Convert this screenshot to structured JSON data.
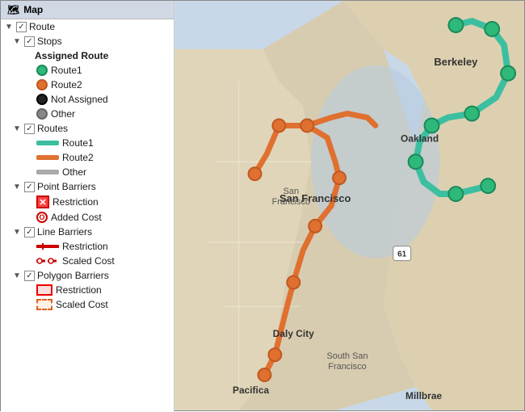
{
  "sidebar": {
    "header": "Map",
    "items": {
      "route": "Route",
      "stops": "Stops",
      "assigned_route": "Assigned Route",
      "route1_stop": "Route1",
      "route2_stop": "Route2",
      "not_assigned": "Not Assigned",
      "other_stop": "Other",
      "routes": "Routes",
      "route1_line": "Route1",
      "route2_line": "Route2",
      "other_line": "Other",
      "point_barriers": "Point Barriers",
      "pb_restriction": "Restriction",
      "pb_added_cost": "Added Cost",
      "line_barriers": "Line Barriers",
      "lb_restriction": "Restriction",
      "lb_scaled_cost": "Scaled Cost",
      "polygon_barriers": "Polygon Barriers",
      "poly_restriction": "Restriction",
      "poly_scaled_cost": "Scaled Cost"
    }
  },
  "map": {
    "labels": {
      "berkeley": "Berkeley",
      "san_francisco": "San Francisco",
      "daly_city": "Daly City",
      "south_san_francisco": "South San Francisco",
      "pacifica": "Pacifica",
      "millbrae": "Millbrae",
      "oakland": "Oakland",
      "highway_61": "61"
    }
  }
}
